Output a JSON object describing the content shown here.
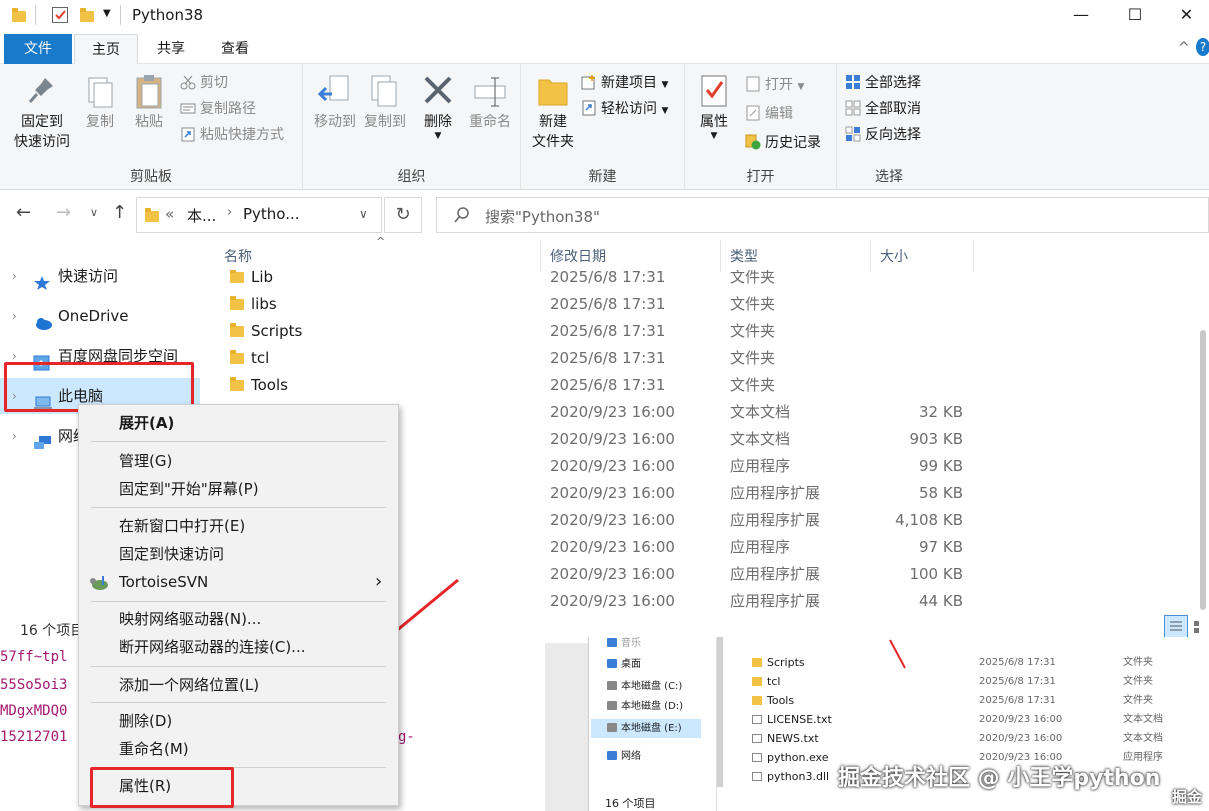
{
  "window": {
    "title": "Python38",
    "minimize": "—",
    "maximize": "☐",
    "close": "✕",
    "help": "?",
    "collapse": "^"
  },
  "tabs": {
    "file": "文件",
    "home": "主页",
    "share": "共享",
    "view": "查看"
  },
  "ribbon": {
    "clipboard": {
      "label": "剪贴板",
      "pin": "固定到\n快速访问",
      "pin_line1": "固定到",
      "pin_line2": "快速访问",
      "copy": "复制",
      "paste": "粘贴",
      "cut": "剪切",
      "copy_path": "复制路径",
      "paste_shortcut": "粘贴快捷方式"
    },
    "organize": {
      "label": "组织",
      "move_to": "移动到",
      "copy_to": "复制到",
      "delete": "删除",
      "rename": "重命名"
    },
    "new": {
      "label": "新建",
      "new_folder_line1": "新建",
      "new_folder_line2": "文件夹",
      "new_item": "新建项目",
      "easy_access": "轻松访问"
    },
    "open": {
      "label": "打开",
      "properties": "属性",
      "open": "打开",
      "edit": "编辑",
      "history": "历史记录"
    },
    "select": {
      "label": "选择",
      "select_all": "全部选择",
      "select_none": "全部取消",
      "invert": "反向选择"
    }
  },
  "address": {
    "crumb1": "本...",
    "crumb2": "Pytho...",
    "overflow": "«",
    "search_placeholder": "搜索\"Python38\""
  },
  "nav": {
    "items": [
      {
        "label": "快速访问"
      },
      {
        "label": "OneDrive"
      },
      {
        "label": "百度网盘同步空间"
      },
      {
        "label": "此电脑"
      },
      {
        "label": "网络"
      }
    ]
  },
  "columns": {
    "name": "名称",
    "date": "修改日期",
    "type": "类型",
    "size": "大小"
  },
  "files": [
    {
      "name": "Lib",
      "date": "2025/6/8 17:31",
      "type": "文件夹",
      "size": ""
    },
    {
      "name": "libs",
      "date": "2025/6/8 17:31",
      "type": "文件夹",
      "size": ""
    },
    {
      "name": "Scripts",
      "date": "2025/6/8 17:31",
      "type": "文件夹",
      "size": ""
    },
    {
      "name": "tcl",
      "date": "2025/6/8 17:31",
      "type": "文件夹",
      "size": ""
    },
    {
      "name": "Tools",
      "date": "2025/6/8 17:31",
      "type": "文件夹",
      "size": ""
    },
    {
      "name": "",
      "date": "2020/9/23 16:00",
      "type": "文本文档",
      "size": "32 KB"
    },
    {
      "name": "",
      "date": "2020/9/23 16:00",
      "type": "文本文档",
      "size": "903 KB"
    },
    {
      "name": "",
      "date": "2020/9/23 16:00",
      "type": "应用程序",
      "size": "99 KB"
    },
    {
      "name": "",
      "date": "2020/9/23 16:00",
      "type": "应用程序扩展",
      "size": "58 KB"
    },
    {
      "name": "",
      "date": "2020/9/23 16:00",
      "type": "应用程序扩展",
      "size": "4,108 KB"
    },
    {
      "name": "",
      "date": "2020/9/23 16:00",
      "type": "应用程序",
      "size": "97 KB"
    },
    {
      "name": "",
      "date": "2020/9/23 16:00",
      "type": "应用程序扩展",
      "size": "100 KB"
    },
    {
      "name": "",
      "date": "2020/9/23 16:00",
      "type": "应用程序扩展",
      "size": "44 KB"
    }
  ],
  "status": "16 个项目",
  "context_menu": {
    "expand": "展开(A)",
    "manage": "管理(G)",
    "pin_start": "固定到\"开始\"屏幕(P)",
    "open_new_window": "在新窗口中打开(E)",
    "pin_quick": "固定到快速访问",
    "tortoise": "TortoiseSVN",
    "map_drive": "映射网络驱动器(N)...",
    "disconnect_drive": "断开网络驱动器的连接(C)...",
    "add_location": "添加一个网络位置(L)",
    "delete": "删除(D)",
    "rename": "重命名(M)",
    "properties": "属性(R)"
  },
  "background_code": [
    "57ff~tpl",
    "55So5oi3",
    "MDgxMDQ0",
    "15212701",
    "g-"
  ],
  "background_window": {
    "nav": [
      "桌面",
      "本地磁盘 (C:)",
      "本地磁盘 (D:)",
      "本地磁盘 (E:)",
      "网络"
    ],
    "nav_top": "音乐",
    "rows": [
      {
        "name": "Scripts",
        "date": "2025/6/8 17:31",
        "type": "文件夹"
      },
      {
        "name": "tcl",
        "date": "2025/6/8 17:31",
        "type": "文件夹"
      },
      {
        "name": "Tools",
        "date": "2025/6/8 17:31",
        "type": "文件夹"
      },
      {
        "name": "LICENSE.txt",
        "date": "2020/9/23 16:00",
        "type": "文本文档"
      },
      {
        "name": "NEWS.txt",
        "date": "2020/9/23 16:00",
        "type": "文本文档"
      },
      {
        "name": "python.exe",
        "date": "2020/9/23 16:00",
        "type": "应用程序"
      },
      {
        "name": "python3.dll",
        "date": "",
        "type": ""
      }
    ],
    "status": "16 个项目"
  },
  "watermark": {
    "main": "掘金技术社区 @ 小王学python",
    "corner": "掘金"
  },
  "colors": {
    "accent": "#1979ca",
    "highlight_red": "#e5262b",
    "folder": "#f2c247"
  }
}
